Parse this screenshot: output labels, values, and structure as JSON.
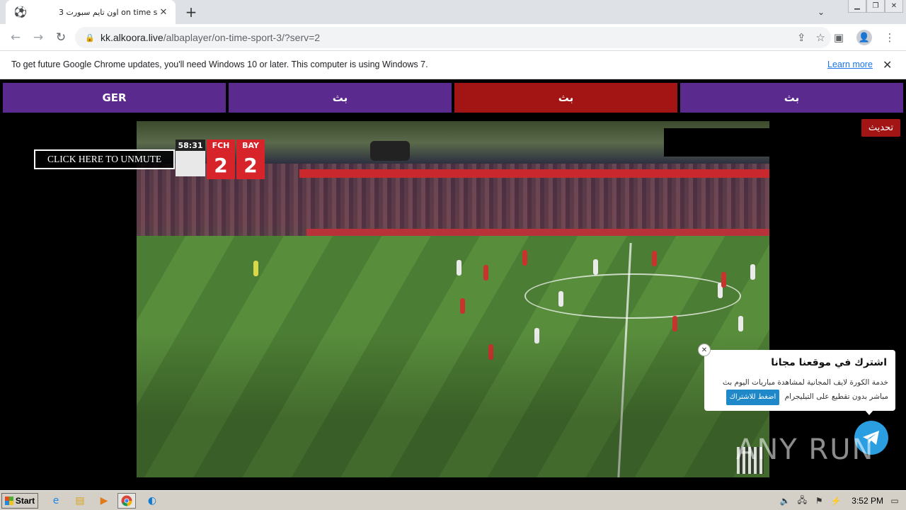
{
  "browser": {
    "tab": {
      "title": "اون تايم سبورت 3 on time sport",
      "favicon": "soccer-ball-icon"
    },
    "url_host": "kk.alkoora.live",
    "url_path": "/albaplayer/on-time-sport-3/?serv=2"
  },
  "infobar": {
    "message": "To get future Google Chrome updates, you'll need Windows 10 or later. This computer is using Windows 7.",
    "link": "Learn more"
  },
  "servers": [
    {
      "label": "GER",
      "active": false
    },
    {
      "label": "بث",
      "active": false
    },
    {
      "label": "بث",
      "active": true
    },
    {
      "label": "بث",
      "active": false
    }
  ],
  "refresh_label": "تحديث",
  "unmute_label": "CLICK HERE TO UNMUTE",
  "scorebug": {
    "time": "58:31",
    "home": {
      "abbr": "FCH",
      "goals": "2"
    },
    "away": {
      "abbr": "BAY",
      "goals": "2"
    }
  },
  "popup": {
    "title": "اشترك في موقعنا مجانا",
    "desc": "خدمة الكورة لايف المجانية لمشاهدة مباريات اليوم بث مباشر بدون تقطيع على التيليجرام",
    "cta": "اضغط للاشتراك"
  },
  "watermark": "ANY RUN",
  "taskbar": {
    "start": "Start",
    "clock": "3:52 PM"
  },
  "colors": {
    "server_purple": "#5b2a8e",
    "server_active": "#a31414",
    "telegram": "#2a9ee0"
  }
}
